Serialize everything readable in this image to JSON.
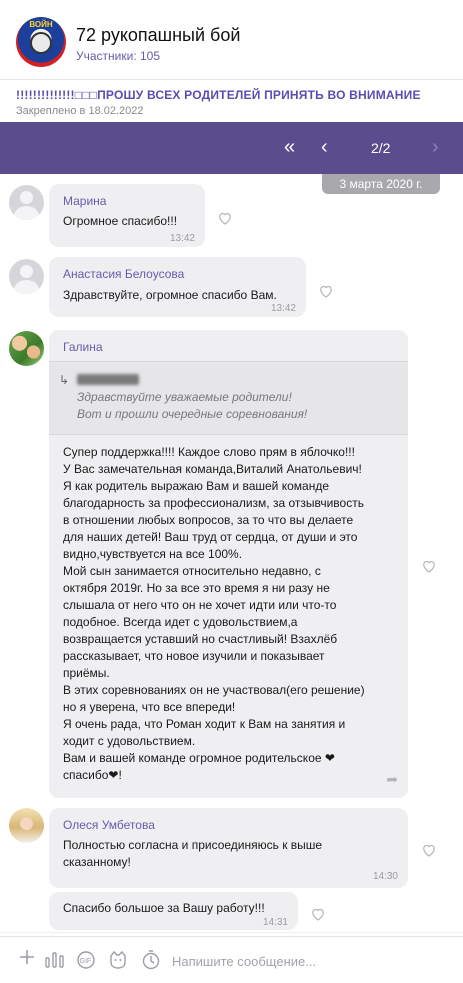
{
  "header": {
    "title": "72 рукопашный бой",
    "members": "Участники: 105",
    "logo_text": "ВОЙН"
  },
  "pinned": {
    "text": "!!!!!!!!!!!!!!□□□ПРОШУ ВСЕХ РОДИТЕЛЕЙ ПРИНЯТЬ ВО ВНИМАНИЕ",
    "date": "Закреплено в 18.02.2022"
  },
  "nav": {
    "first": "«",
    "prev": "‹",
    "counter": "2/2",
    "next": "›"
  },
  "date_separator": "3 марта 2020 г.",
  "messages": [
    {
      "sender": "Марина",
      "text": "Огромное спасибо!!!",
      "time": "13:42"
    },
    {
      "sender": "Анастасия Белоусова",
      "text": "Здравствуйте, огромное спасибо Вам.",
      "time": "13:42"
    },
    {
      "sender": "Галина",
      "quote_text": "Здравствуйте уважаемые родители!\nВот и прошли очередные соревнования!",
      "text": "Супер поддержка!!!! Каждое слово прям в яблочко!!!\nУ Вас замечательная команда,Виталий Анатольевич!\nЯ как родитель выражаю Вам и вашей команде\nблагодарность за профессионализм, за отзывчивость\nв отношении любых вопросов, за то что вы делаете\nдля наших детей! Ваш труд от сердца, от души и это\nвидно,чувствуется на все 100%.\nМой сын занимается относительно недавно,  с\nоктября 2019г. Но за все это время я ни разу не\nслышала от него что он не хочет идти или что-то\nподобное. Всегда идет с удовольствием,а\nвозвращается уставший но счастливый! Взахлёб\nрассказывает, что новое изучили и показывает\nприёмы.\nВ этих соревнованиях он не участвовал(его решение)\nно я уверена, что все впереди!\nЯ очень рада, что  Роман ходит к Вам на занятия и\nходит с удовольствием.\nВам и вашей команде  огромное родительское ❤\nспасибо❤!"
    },
    {
      "sender": "Олеся Умбетова",
      "text": "Полностью согласна и присоединяюсь к выше\nсказанному!",
      "time": "14:30"
    },
    {
      "text": "Спасибо большое за Вашу работу!!!",
      "time": "14:31"
    }
  ],
  "composer": {
    "placeholder": "Напишите сообщение..."
  },
  "icons": {
    "plus": "plus-icon",
    "poll": "poll-icon",
    "gif": "gif-icon",
    "sticker": "sticker-icon",
    "timer": "timer-icon"
  },
  "colors": {
    "accent": "#665cac",
    "navbar": "#5a4d8e",
    "bubble": "#efeff2"
  }
}
